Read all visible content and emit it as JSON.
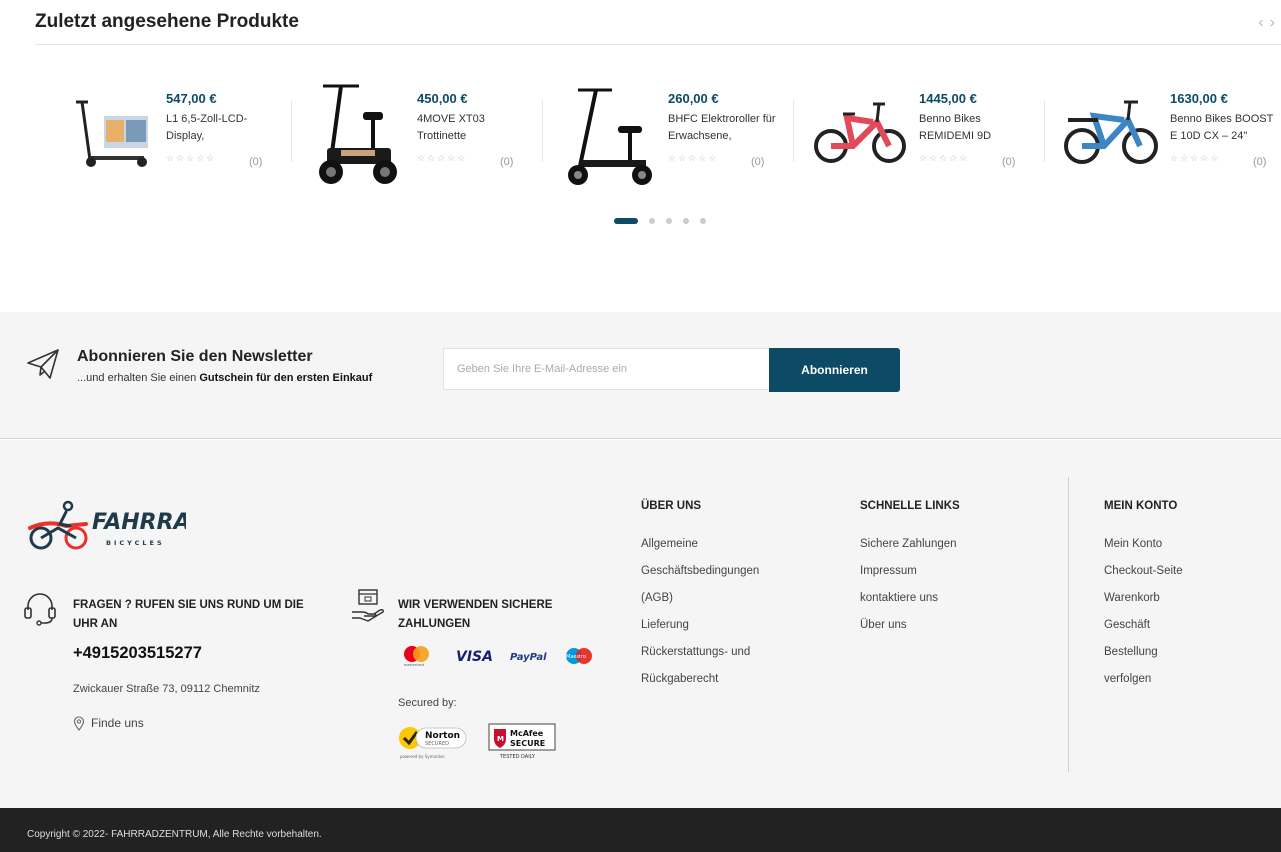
{
  "recent": {
    "title": "Zuletzt angesehene Produkte",
    "nav_prev": "‹",
    "nav_next": "›",
    "products": [
      {
        "price": "547,00 €",
        "name": "L1 6,5-Zoll-LCD-Display,",
        "stars": "☆☆☆☆☆",
        "count": "(0)",
        "image": "e-scooter-image"
      },
      {
        "price": "450,00 €",
        "name": "4MOVE XT03 Trottinette",
        "stars": "☆☆☆☆☆",
        "count": "(0)",
        "image": "seated-scooter-image"
      },
      {
        "price": "260,00 €",
        "name": "BHFC Elektroroller für Erwachsene,",
        "stars": "☆☆☆☆☆",
        "count": "(0)",
        "image": "scooter-with-seat-image"
      },
      {
        "price": "1445,00 €",
        "name": "Benno Bikes REMIDEMI 9D",
        "stars": "☆☆☆☆☆",
        "count": "(0)",
        "image": "red-bike-image"
      },
      {
        "price": "1630,00 €",
        "name": "Benno Bikes BOOST E 10D CX – 24\"",
        "stars": "☆☆☆☆☆",
        "count": "(0)",
        "image": "blue-bike-image"
      }
    ],
    "pagination": {
      "pages": 5,
      "current": 1
    }
  },
  "newsletter": {
    "title": "Abonnieren Sie den Newsletter",
    "subtitle_prefix": "...und erhalten Sie einen ",
    "subtitle_bold": "Gutschein für den ersten Einkauf",
    "placeholder": "Geben Sie Ihre E-Mail-Adresse ein",
    "button": "Abonnieren",
    "icon": "paper-plane-icon"
  },
  "footer": {
    "logo_text": "FAHRRAD",
    "logo_sub": "BICYCLES",
    "contact": {
      "title": "FRAGEN ? RUFEN SIE UNS RUND UM DIE UHR AN",
      "phone": "+4915203515277",
      "address": "Zwickauer Straße 73, 09112 Chemnitz",
      "find": "Finde uns",
      "icon": "headset-icon"
    },
    "payment": {
      "title": "WIR VERWENDEN SICHERE ZAHLUNGEN",
      "icon": "hand-payment-icon",
      "cards": [
        "mastercard",
        "VISA",
        "PayPal",
        "Maestro"
      ],
      "secured_label": "Secured by:",
      "norton": {
        "name": "Norton",
        "sub": "SECURED",
        "powered": "powered by Symantec"
      },
      "mcafee": {
        "name": "McAfee",
        "sub": "SECURE",
        "tested": "TESTED DAILY"
      }
    },
    "about": {
      "heading": "ÜBER UNS",
      "links": [
        "Allgemeine",
        "Geschäftsbedingungen",
        "(AGB)",
        "Lieferung",
        "Rückerstattungs- und",
        "Rückgaberecht"
      ]
    },
    "quick": {
      "heading": "SCHNELLE LINKS",
      "links": [
        "Sichere Zahlungen",
        "Impressum",
        "kontaktiere uns",
        "Über uns"
      ]
    },
    "account": {
      "heading": "MEIN KONTO",
      "links": [
        "Mein Konto",
        "Checkout-Seite",
        "Warenkorb",
        "Geschäft",
        "Bestellung",
        "verfolgen"
      ]
    }
  },
  "copyright": "Copyright © 2022- FAHRRADZENTRUM, Alle Rechte vorbehalten.",
  "colors": {
    "accent": "#0c4a66",
    "logo_red": "#e8312a",
    "logo_dark": "#1f3a4a",
    "footer_bg": "#f5f5f5",
    "bottom_bar": "#222222"
  }
}
